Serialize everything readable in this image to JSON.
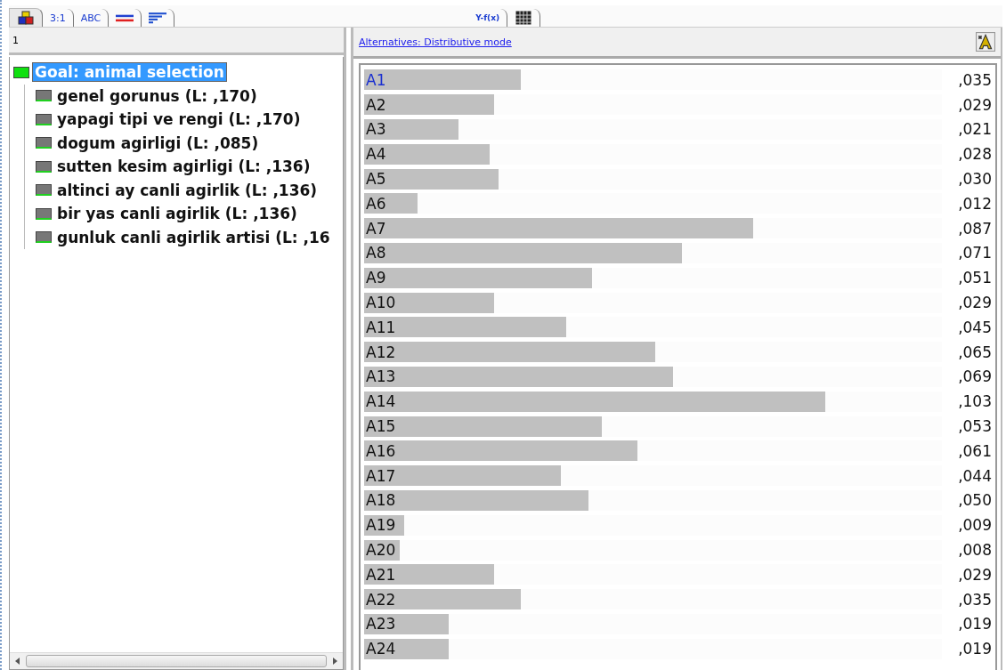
{
  "tabs": [
    {
      "kind": "cubes",
      "selected": true
    },
    {
      "kind": "text",
      "label": "3:1",
      "selected": false
    },
    {
      "kind": "text",
      "label": "ABC",
      "selected": false
    },
    {
      "kind": "lines",
      "selected": false
    },
    {
      "kind": "bars",
      "selected": false
    },
    {
      "kind": "text",
      "label": "Y-f(x)",
      "selected": false
    },
    {
      "kind": "grid",
      "selected": false
    }
  ],
  "left_panel": {
    "header": "1",
    "tree": {
      "label": "Goal: animal selection",
      "selected": true,
      "children": [
        {
          "label": "genel gorunus (L: ,170)"
        },
        {
          "label": "yapagi tipi ve rengi (L: ,170)"
        },
        {
          "label": "dogum agirligi (L: ,085)"
        },
        {
          "label": "sutten kesim agirligi (L: ,136)"
        },
        {
          "label": "altinci ay canli agirlik (L: ,136)"
        },
        {
          "label": "bir yas canli agirlik (L: ,136)"
        },
        {
          "label": "gunluk canli agirlik artisi (L: ,16"
        }
      ]
    }
  },
  "right_panel": {
    "link": "Alternatives: Distributive mode",
    "alternatives": [
      {
        "name": "A1",
        "value": ",035",
        "level": 0.271,
        "selected": true
      },
      {
        "name": "A2",
        "value": ",029",
        "level": 0.225,
        "selected": false
      },
      {
        "name": "A3",
        "value": ",021",
        "level": 0.163,
        "selected": false
      },
      {
        "name": "A4",
        "value": ",028",
        "level": 0.217,
        "selected": false
      },
      {
        "name": "A5",
        "value": ",030",
        "level": 0.233,
        "selected": false
      },
      {
        "name": "A6",
        "value": ",012",
        "level": 0.093,
        "selected": false
      },
      {
        "name": "A7",
        "value": ",087",
        "level": 0.674,
        "selected": false
      },
      {
        "name": "A8",
        "value": ",071",
        "level": 0.55,
        "selected": false
      },
      {
        "name": "A9",
        "value": ",051",
        "level": 0.395,
        "selected": false
      },
      {
        "name": "A10",
        "value": ",029",
        "level": 0.225,
        "selected": false
      },
      {
        "name": "A11",
        "value": ",045",
        "level": 0.349,
        "selected": false
      },
      {
        "name": "A12",
        "value": ",065",
        "level": 0.504,
        "selected": false
      },
      {
        "name": "A13",
        "value": ",069",
        "level": 0.535,
        "selected": false
      },
      {
        "name": "A14",
        "value": ",103",
        "level": 0.798,
        "selected": false
      },
      {
        "name": "A15",
        "value": ",053",
        "level": 0.411,
        "selected": false
      },
      {
        "name": "A16",
        "value": ",061",
        "level": 0.473,
        "selected": false
      },
      {
        "name": "A17",
        "value": ",044",
        "level": 0.341,
        "selected": false
      },
      {
        "name": "A18",
        "value": ",050",
        "level": 0.388,
        "selected": false
      },
      {
        "name": "A19",
        "value": ",009",
        "level": 0.07,
        "selected": false
      },
      {
        "name": "A20",
        "value": ",008",
        "level": 0.062,
        "selected": false
      },
      {
        "name": "A21",
        "value": ",029",
        "level": 0.225,
        "selected": false
      },
      {
        "name": "A22",
        "value": ",035",
        "level": 0.271,
        "selected": false
      },
      {
        "name": "A23",
        "value": ",019",
        "level": 0.147,
        "selected": false
      },
      {
        "name": "A24",
        "value": ",019",
        "level": 0.147,
        "selected": false
      }
    ]
  }
}
